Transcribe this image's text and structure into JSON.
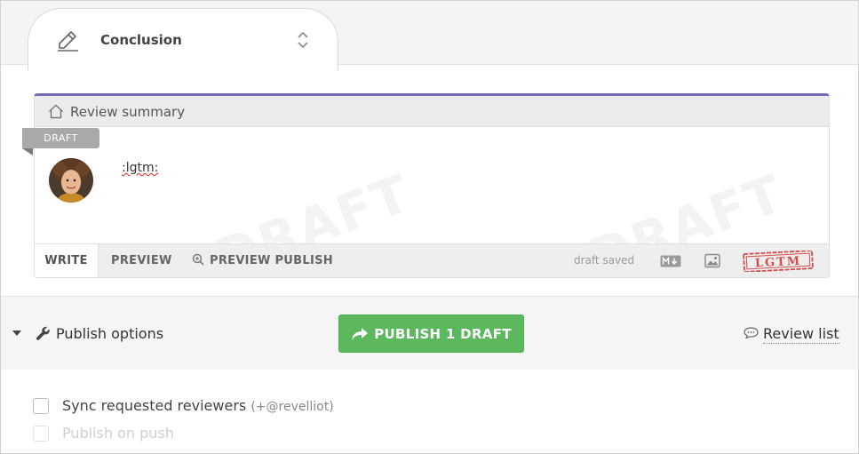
{
  "tab": {
    "title": "Conclusion",
    "icon": "pencil-icon"
  },
  "card": {
    "header_label": "Review summary",
    "draft_badge": "DRAFT",
    "watermark": "DRAFT",
    "comment_text": ":lgtm:",
    "accent_color": "#7b6bb4"
  },
  "editor_tabs": {
    "write": "WRITE",
    "preview": "PREVIEW",
    "preview_publish": "PREVIEW PUBLISH"
  },
  "status": {
    "draft_saved": "draft saved"
  },
  "stamp": {
    "text": "LGTM"
  },
  "publish_bar": {
    "options_label": "Publish options",
    "publish_button": "PUBLISH 1 DRAFT",
    "publish_color": "#5cb85c",
    "review_list": "Review list"
  },
  "options": {
    "sync_label": "Sync requested reviewers",
    "sync_hint": "(+@revelliot)",
    "publish_on_push": "Publish on push"
  }
}
